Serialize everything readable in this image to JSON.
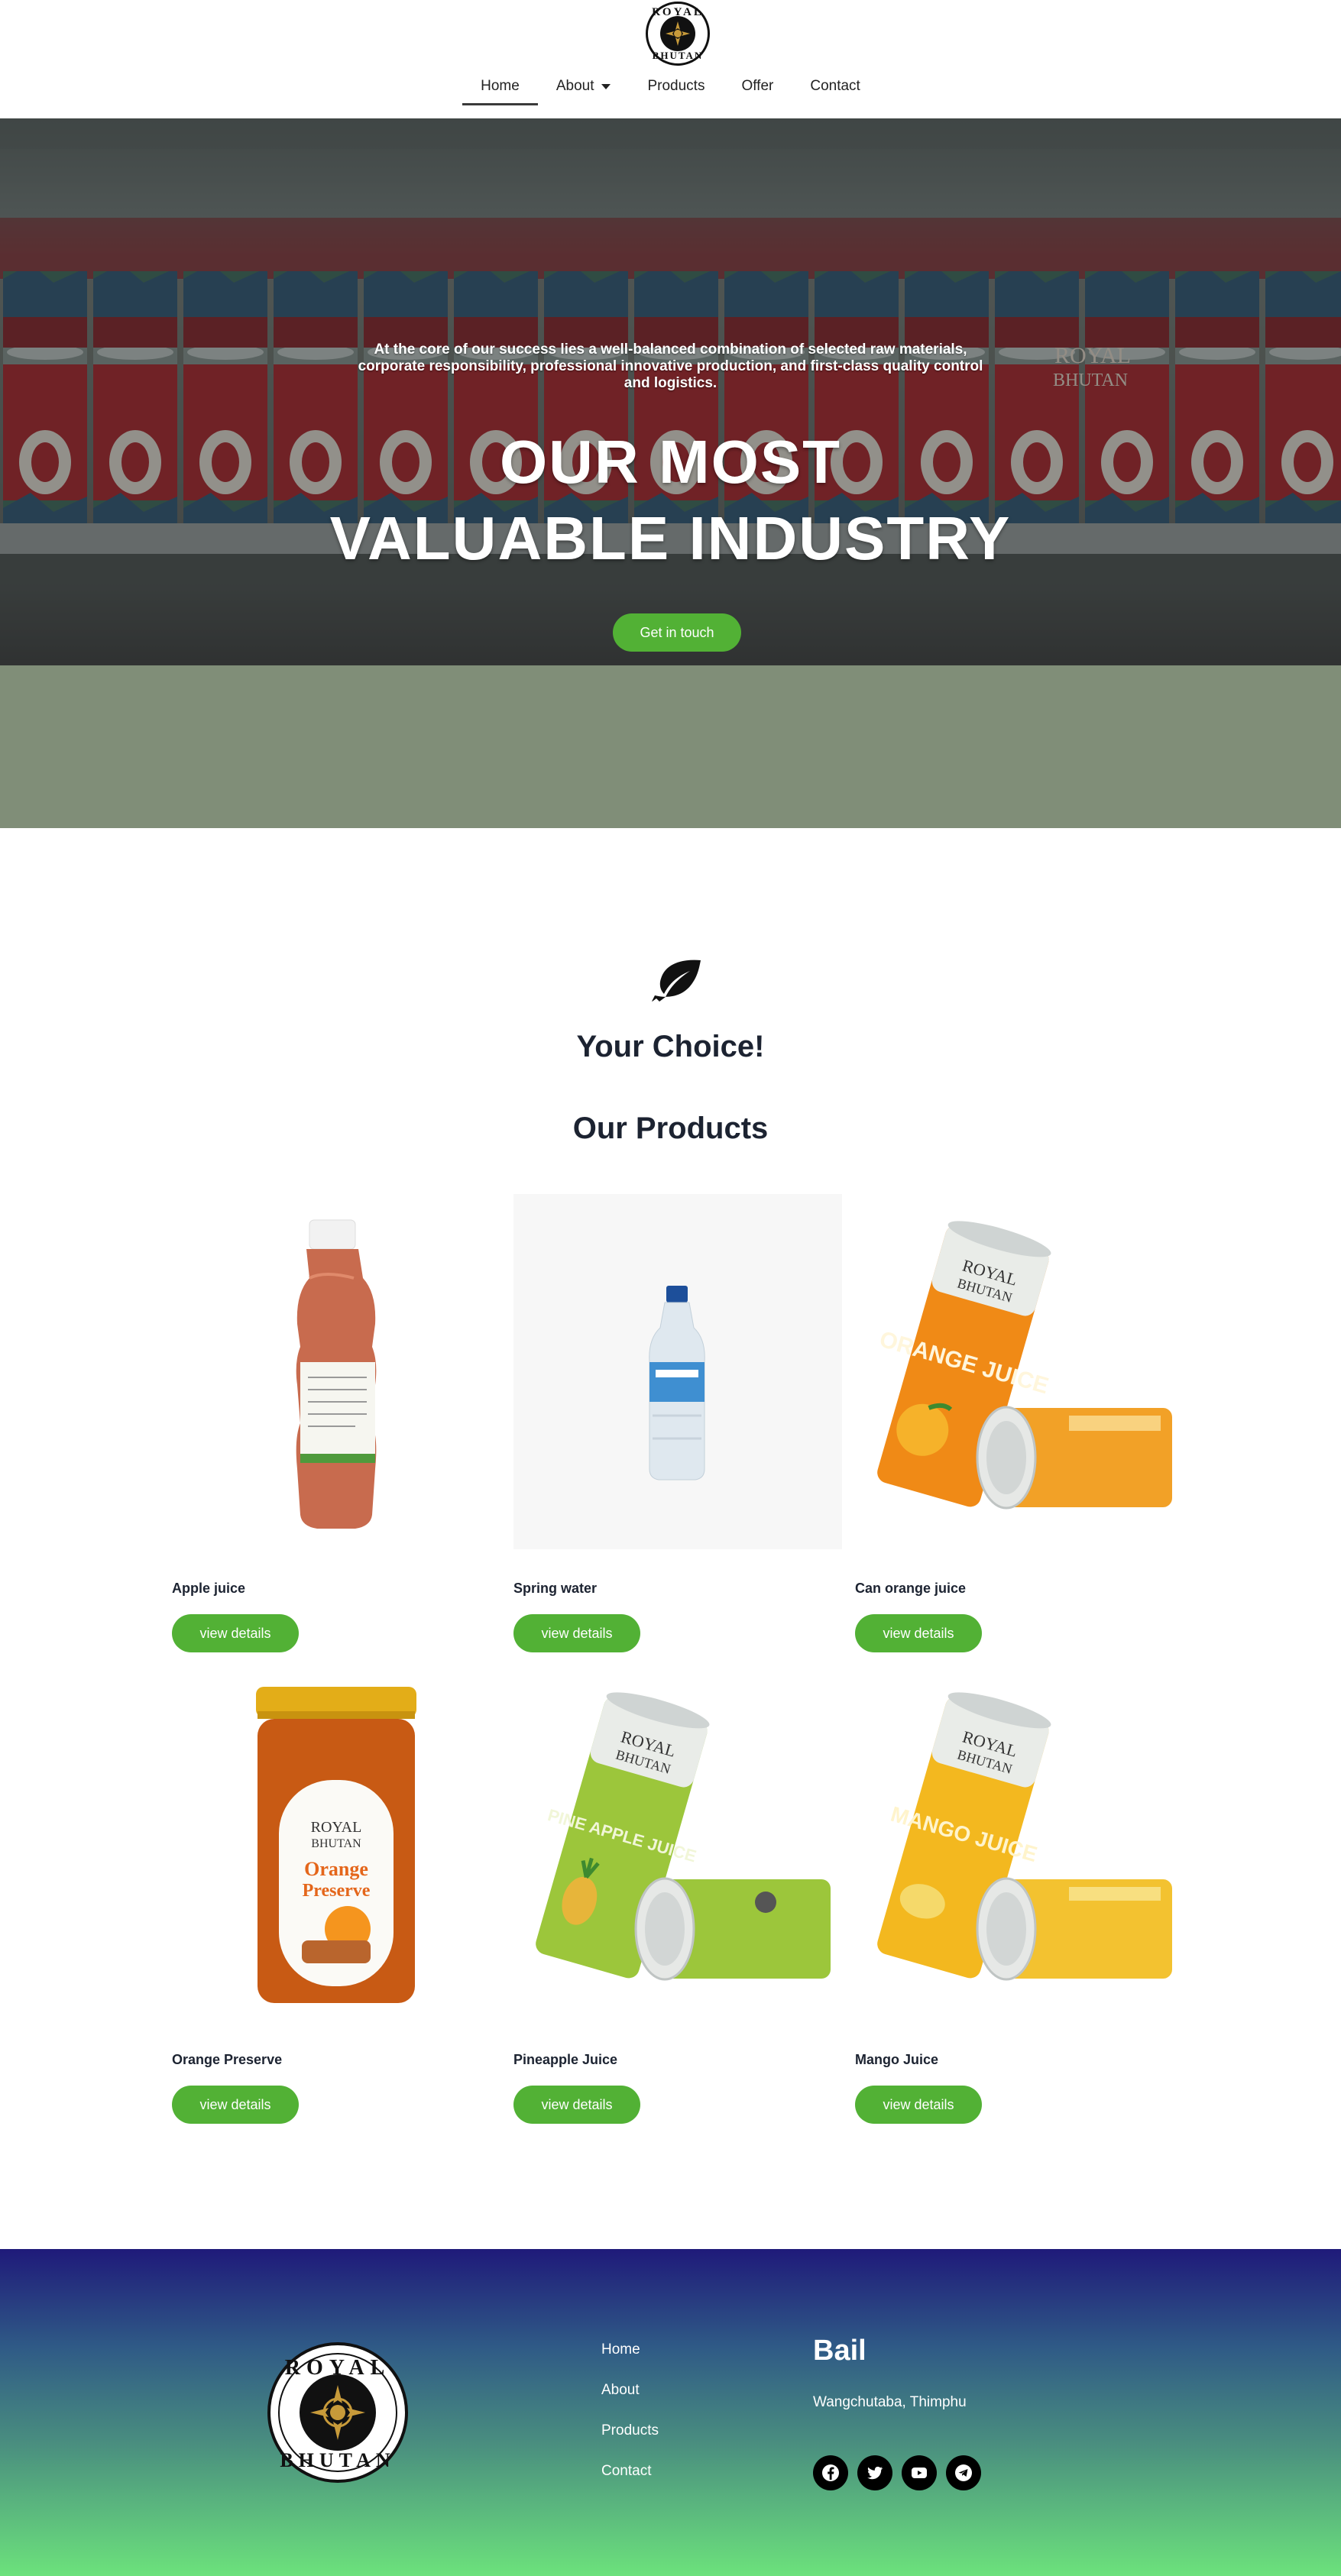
{
  "brand": {
    "logo_top": "ROYAL",
    "logo_bottom": "BHUTAN"
  },
  "nav": {
    "items": [
      {
        "label": "Home",
        "active": true
      },
      {
        "label": "About",
        "dropdown": true
      },
      {
        "label": "Products"
      },
      {
        "label": "Offer"
      },
      {
        "label": "Contact"
      }
    ]
  },
  "hero": {
    "subtitle": "At the core of our success lies a well-balanced combination of selected raw materials, corporate responsibility, professional innovative production, and first-class quality control and logistics.",
    "title_line1": "OUR MOST",
    "title_line2": "VALUABLE INDUSTRY",
    "cta": "Get in touch",
    "can_label_1": "ROYAL",
    "can_label_2": "BHUTAN"
  },
  "section": {
    "kicker": "Your Choice!",
    "heading": "Our Products"
  },
  "products": [
    {
      "name": "Apple juice",
      "button": "view details"
    },
    {
      "name": "Spring water",
      "button": "view details"
    },
    {
      "name": "Can orange juice",
      "button": "view details",
      "img_text_1": "ROYAL",
      "img_text_2": "BHUTAN",
      "img_text_3": "ORANGE JUICE"
    },
    {
      "name": "Orange Preserve",
      "button": "view details",
      "img_text_1": "ROYAL",
      "img_text_2": "BHUTAN",
      "img_text_3": "Orange",
      "img_text_4": "Preserve"
    },
    {
      "name": "Pineapple Juice",
      "button": "view details",
      "img_text_1": "ROYAL",
      "img_text_2": "BHUTAN",
      "img_text_3": "PINE APPLE JUICE"
    },
    {
      "name": "Mango Juice",
      "button": "view details",
      "img_text_1": "ROYAL",
      "img_text_2": "BHUTAN",
      "img_text_3": "MANGO JUICE"
    }
  ],
  "footer": {
    "links": [
      "Home",
      "About",
      "Products",
      "Contact"
    ],
    "brand": "Bail",
    "address": "Wangchutaba, Thimphu",
    "social_icons": [
      "facebook-icon",
      "twitter-icon",
      "youtube-icon",
      "telegram-icon"
    ]
  },
  "colors": {
    "accent_green": "#52b135",
    "band": "#808e78",
    "footer_top": "#1f1a7a",
    "footer_bottom": "#6ce27c"
  }
}
